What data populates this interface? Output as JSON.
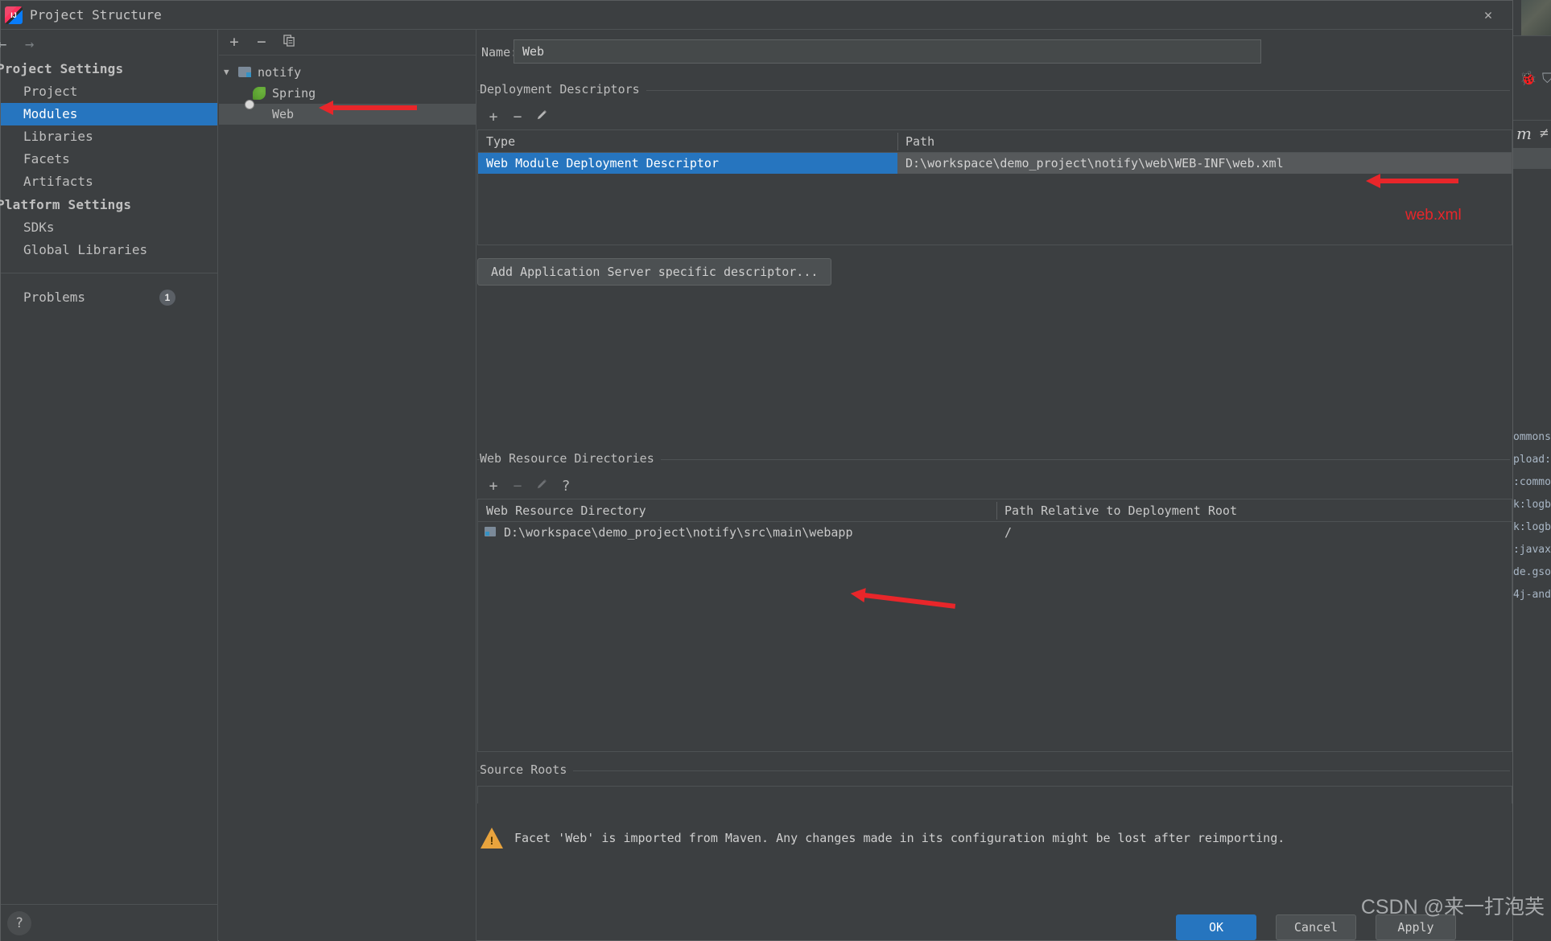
{
  "window": {
    "title": "Project Structure",
    "logo_text": "IJ",
    "close_icon": "close-icon"
  },
  "sidebar": {
    "back_icon": "←",
    "forward_icon": "→",
    "groups": [
      {
        "label": "Project Settings",
        "items": [
          {
            "label": "Project",
            "selected": false
          },
          {
            "label": "Modules",
            "selected": true
          },
          {
            "label": "Libraries",
            "selected": false
          },
          {
            "label": "Facets",
            "selected": false
          },
          {
            "label": "Artifacts",
            "selected": false
          }
        ]
      },
      {
        "label": "Platform Settings",
        "items": [
          {
            "label": "SDKs",
            "selected": false
          },
          {
            "label": "Global Libraries",
            "selected": false
          }
        ]
      }
    ],
    "problems": {
      "label": "Problems",
      "count": "1"
    },
    "help_label": "?"
  },
  "tree": {
    "toolbar": [
      {
        "name": "add-module-button",
        "glyph": "+"
      },
      {
        "name": "remove-module-button",
        "glyph": "−"
      },
      {
        "name": "copy-module-button",
        "glyph": "❐"
      }
    ],
    "nodes": [
      {
        "label": "notify",
        "icon": "module-folder-icon",
        "level": 0,
        "expanded": true,
        "selected": false
      },
      {
        "label": "Spring",
        "icon": "spring-facet-icon",
        "level": 1,
        "expanded": false,
        "selected": false
      },
      {
        "label": "Web",
        "icon": "web-facet-icon",
        "level": 1,
        "expanded": false,
        "selected": true
      }
    ]
  },
  "main": {
    "name_label": "Name:",
    "name_value": "Web",
    "deployment": {
      "section_title": "Deployment Descriptors",
      "toolbar": [
        {
          "name": "add-descriptor-button",
          "glyph": "+",
          "disabled": false
        },
        {
          "name": "remove-descriptor-button",
          "glyph": "−",
          "disabled": false
        },
        {
          "name": "edit-descriptor-button",
          "glyph": "✎",
          "disabled": false
        }
      ],
      "columns": [
        "Type",
        "Path"
      ],
      "rows": [
        {
          "type": "Web Module Deployment Descriptor",
          "path": "D:\\workspace\\demo_project\\notify\\web\\WEB-INF\\web.xml",
          "selected": true
        }
      ],
      "add_server_button": "Add Application Server specific descriptor..."
    },
    "web_resources": {
      "section_title": "Web Resource Directories",
      "toolbar": [
        {
          "name": "add-web-resource-button",
          "glyph": "+",
          "disabled": false
        },
        {
          "name": "remove-web-resource-button",
          "glyph": "−",
          "disabled": true
        },
        {
          "name": "edit-web-resource-button",
          "glyph": "✎",
          "disabled": true
        },
        {
          "name": "help-web-resource-button",
          "glyph": "?",
          "disabled": false
        }
      ],
      "columns": [
        "Web Resource Directory",
        "Path Relative to Deployment Root"
      ],
      "rows": [
        {
          "directory": "D:\\workspace\\demo_project\\notify\\src\\main\\webapp",
          "relative_path": "/"
        }
      ]
    },
    "source_roots": {
      "section_title": "Source Roots"
    },
    "warning": {
      "icon": "warning-triangle-icon",
      "text": "Facet 'Web' is imported from Maven. Any changes made in its configuration might be lost after reimporting."
    }
  },
  "buttons": {
    "ok": "OK",
    "cancel": "Cancel",
    "apply": "Apply"
  },
  "annotations": {
    "web_xml_label": "web.xml",
    "arrow_color": "#e8262a"
  },
  "watermark": "CSDN @来一打泡芙",
  "background_ide": {
    "bug_icon": "🐞",
    "shield_icon": "⛉",
    "maven_letter": "m",
    "code_glyph": "≠",
    "library_fragments": [
      "ommons-",
      "pload:",
      ":commo",
      "k:logb",
      "k:logb",
      ":javax",
      "de.gso",
      "4j-and"
    ]
  }
}
